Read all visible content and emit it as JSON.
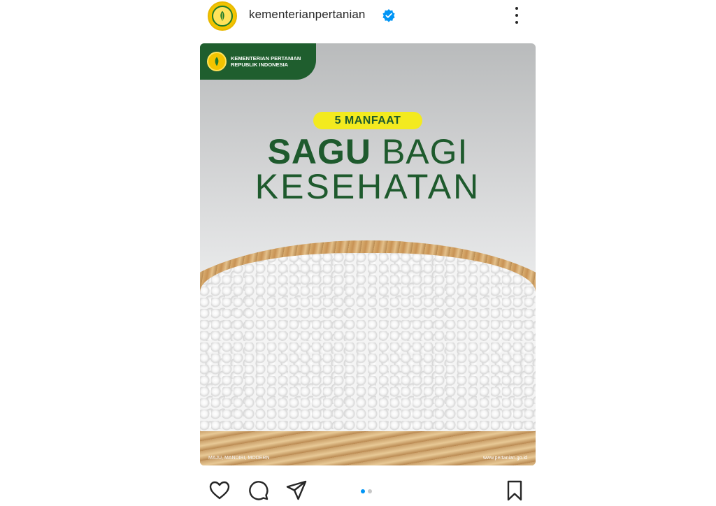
{
  "header": {
    "username": "kementerianpertanian",
    "verified": true,
    "menu_icon": "more-vertical-icon"
  },
  "post": {
    "brand_line1": "KEMENTERIAN PERTANIAN",
    "brand_line2": "REPUBLIK INDONESIA",
    "pill": "5 MANFAAT",
    "headline_bold": "SAGU",
    "headline_thin": "BAGI",
    "headline_line2": "KESEHATAN",
    "footer_left": "MAJU, MANDIRI, MODERN",
    "footer_right": "www.pertanian.go.id"
  },
  "actions": {
    "icons": [
      "heart-icon",
      "comment-icon",
      "share-icon",
      "bookmark-icon"
    ],
    "carousel_total": 2,
    "carousel_active": 1
  },
  "colors": {
    "brand_green": "#1e5a2d",
    "pill_yellow": "#f3ea1f",
    "verified_blue": "#0095f6"
  }
}
